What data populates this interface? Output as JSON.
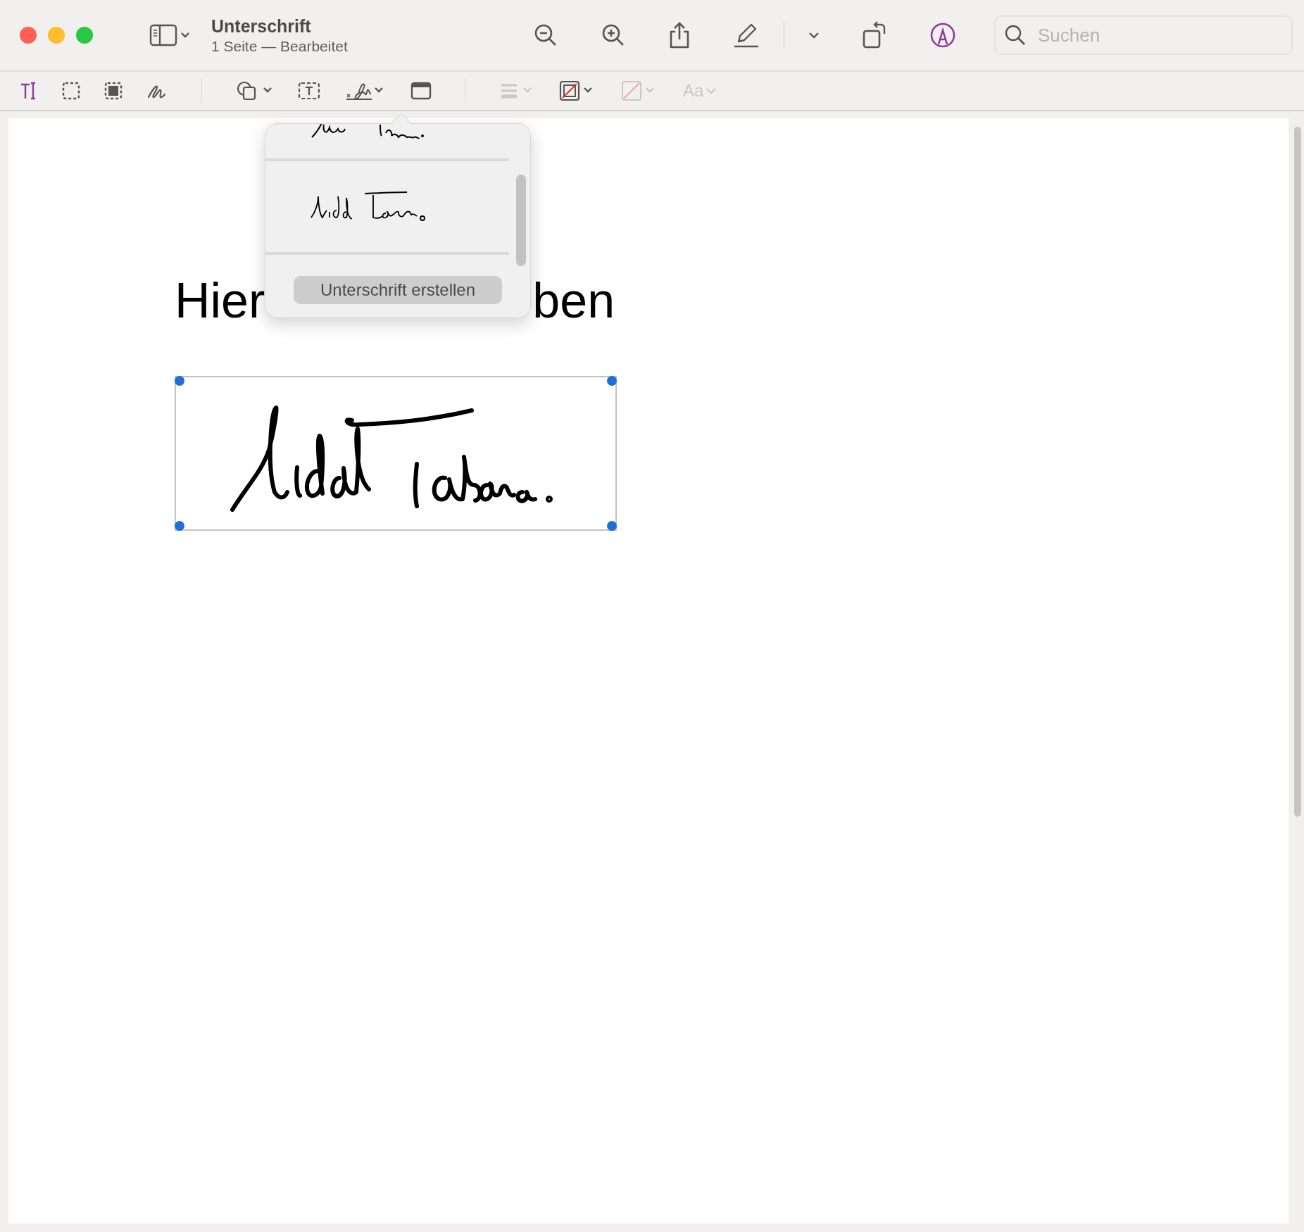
{
  "window": {
    "title": "Unterschrift",
    "subtitle": "1 Seite — Bearbeitet"
  },
  "search": {
    "placeholder": "Suchen"
  },
  "markup": {
    "on": true
  },
  "tools": [
    {
      "kind": "text-select",
      "selected": true,
      "disabled": false
    },
    {
      "kind": "rect-select",
      "selected": false,
      "disabled": false
    },
    {
      "kind": "smart-select",
      "selected": false,
      "disabled": false
    },
    {
      "kind": "sketch",
      "selected": false,
      "disabled": false
    },
    {
      "kind": "divider"
    },
    {
      "kind": "shapes",
      "selected": false,
      "disabled": false
    },
    {
      "kind": "textbox",
      "selected": false,
      "disabled": false
    },
    {
      "kind": "sign",
      "selected": false,
      "disabled": false
    },
    {
      "kind": "note",
      "selected": false,
      "disabled": false
    },
    {
      "kind": "divider"
    },
    {
      "kind": "lines",
      "selected": false,
      "disabled": true
    },
    {
      "kind": "border",
      "selected": false,
      "disabled": false
    },
    {
      "kind": "fill",
      "selected": false,
      "disabled": true
    },
    {
      "kind": "font",
      "selected": false,
      "disabled": true,
      "label": "Aa"
    }
  ],
  "popover": {
    "button": "Unterschrift erstellen"
  },
  "document": {
    "heading_parts": [
      "Hier",
      "ben"
    ],
    "signature": {
      "selected": true
    }
  }
}
